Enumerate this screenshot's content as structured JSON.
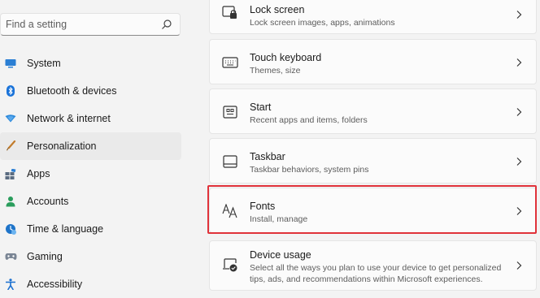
{
  "search": {
    "placeholder": "Find a setting",
    "icon": "search-icon"
  },
  "sidebar": {
    "items": [
      {
        "label": "System",
        "icon": "system-icon",
        "selected": false
      },
      {
        "label": "Bluetooth & devices",
        "icon": "bluetooth-icon",
        "selected": false
      },
      {
        "label": "Network & internet",
        "icon": "network-icon",
        "selected": false
      },
      {
        "label": "Personalization",
        "icon": "personalization-icon",
        "selected": true
      },
      {
        "label": "Apps",
        "icon": "apps-icon",
        "selected": false
      },
      {
        "label": "Accounts",
        "icon": "accounts-icon",
        "selected": false
      },
      {
        "label": "Time & language",
        "icon": "time-language-icon",
        "selected": false
      },
      {
        "label": "Gaming",
        "icon": "gaming-icon",
        "selected": false
      },
      {
        "label": "Accessibility",
        "icon": "accessibility-icon",
        "selected": false
      }
    ]
  },
  "settings": [
    {
      "title": "Lock screen",
      "subtitle": "Lock screen images, apps, animations",
      "icon": "lock-screen-icon"
    },
    {
      "title": "Touch keyboard",
      "subtitle": "Themes, size",
      "icon": "keyboard-icon"
    },
    {
      "title": "Start",
      "subtitle": "Recent apps and items, folders",
      "icon": "start-icon"
    },
    {
      "title": "Taskbar",
      "subtitle": "Taskbar behaviors, system pins",
      "icon": "taskbar-icon"
    },
    {
      "title": "Fonts",
      "subtitle": "Install, manage",
      "icon": "fonts-icon",
      "highlighted": true
    },
    {
      "title": "Device usage",
      "subtitle": "Select all the ways you plan to use your device to get personalized tips, ads, and recommendations within Microsoft experiences.",
      "icon": "device-usage-icon"
    }
  ],
  "colors": {
    "accent": "#0067c0",
    "highlight_border": "#e0323a",
    "selected_bg": "#eaeaea"
  }
}
